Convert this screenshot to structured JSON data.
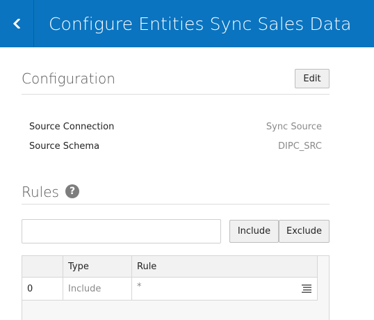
{
  "header": {
    "title": "Configure Entities Sync Sales Data",
    "back_icon": "chevron-left-icon",
    "background": "#0a74c0"
  },
  "configuration": {
    "title": "Configuration",
    "edit_label": "Edit",
    "fields": [
      {
        "label": "Source Connection",
        "value": "Sync Source"
      },
      {
        "label": "Source Schema",
        "value": "DIPC_SRC"
      }
    ]
  },
  "rules": {
    "title": "Rules",
    "help_icon": "question-circle-icon",
    "input_value": "",
    "input_placeholder": "",
    "include_label": "Include",
    "exclude_label": "Exclude",
    "table": {
      "columns": [
        "",
        "Type",
        "Rule"
      ],
      "rows": [
        {
          "index": "0",
          "type": "Include",
          "rule": "*",
          "row_menu_icon": "menu-lines-icon"
        }
      ]
    }
  }
}
